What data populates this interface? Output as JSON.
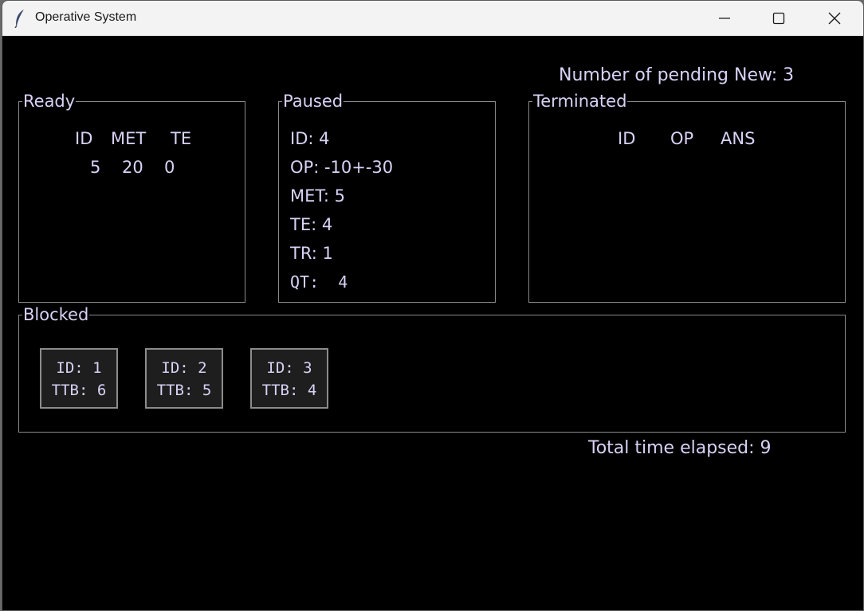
{
  "window": {
    "title": "Operative System"
  },
  "pending": {
    "text": "Number of pending New: 3"
  },
  "ready": {
    "label": "Ready",
    "headers": [
      "ID",
      "MET",
      "TE"
    ],
    "rows": [
      {
        "id": "5",
        "met": "20",
        "te": "0"
      }
    ]
  },
  "paused": {
    "label": "Paused",
    "lines": [
      "ID: 4",
      "OP: -10+-30",
      "MET: 5",
      "TE: 4",
      "TR: 1",
      "QT:  4"
    ]
  },
  "terminated": {
    "label": "Terminated",
    "headers": [
      "ID",
      "OP",
      "ANS"
    ]
  },
  "blocked": {
    "label": "Blocked",
    "cards": [
      {
        "id": "ID: 1",
        "ttb": "TTB: 6"
      },
      {
        "id": "ID: 2",
        "ttb": "TTB: 5"
      },
      {
        "id": "ID: 3",
        "ttb": "TTB: 4"
      }
    ]
  },
  "elapsed": {
    "text": "Total time elapsed: 9"
  }
}
